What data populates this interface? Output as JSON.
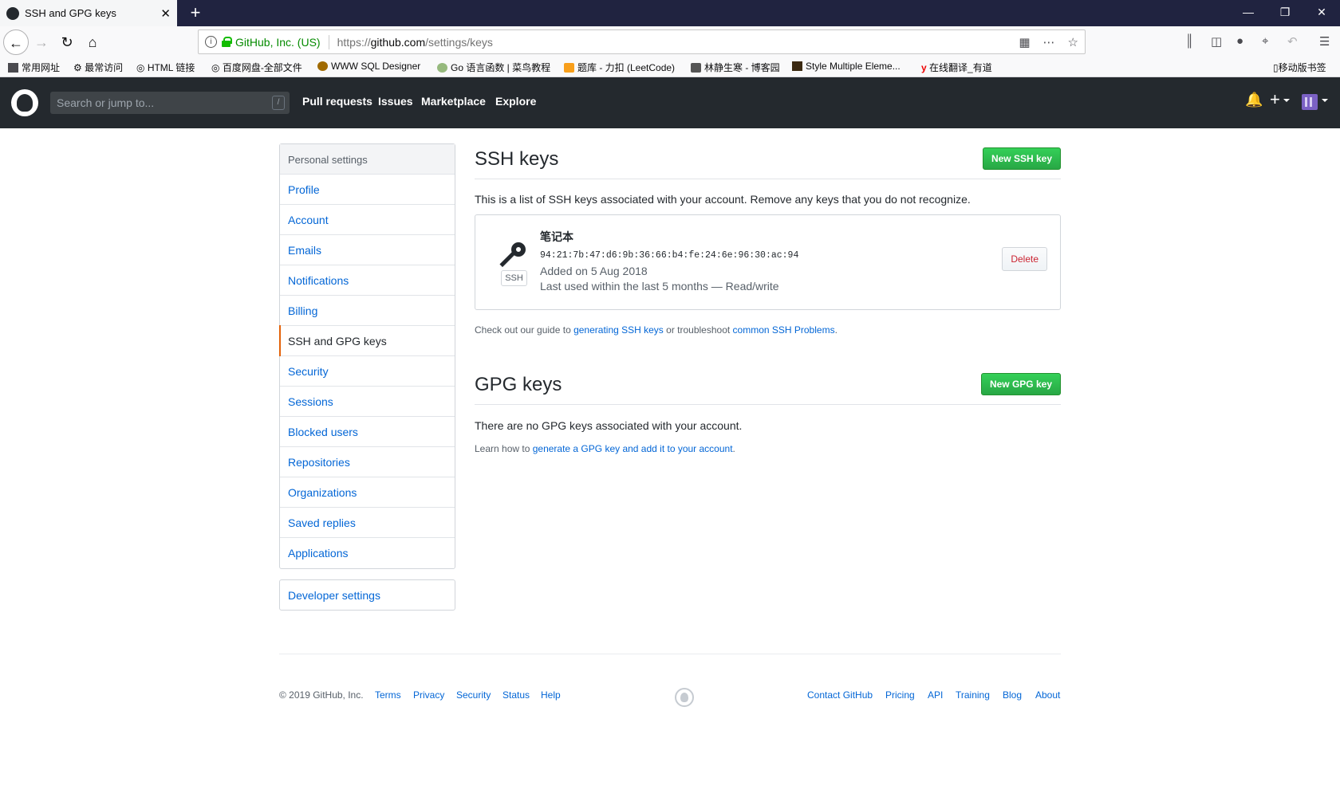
{
  "browser": {
    "tab_title": "SSH and GPG keys",
    "tab_close": "✕",
    "new_tab": "+",
    "window_controls": [
      "—",
      "❐",
      "✕"
    ],
    "url_identity": "GitHub, Inc. (US)",
    "url_prefix": "https://",
    "url_domain": "github.com",
    "url_path": "/settings/keys",
    "url_icons": [
      "qr-code-icon",
      "more-icon",
      "bookmark-star-icon"
    ],
    "toolbar_icons": [
      "library-icon",
      "sidebar-icon",
      "chat-icon",
      "crop-icon",
      "undo-icon",
      "menu-icon"
    ],
    "bookmarks": [
      "常用网址",
      "最常访问",
      "HTML 链接",
      "百度网盘-全部文件",
      "WWW SQL Designer",
      "Go 语言函数 | 菜鸟教程",
      "题库 - 力扣 (LeetCode)",
      "林静生寒 - 博客园",
      "Style Multiple Eleme...",
      "在线翻译_有道"
    ],
    "mobile_bookmarks": "移动版书签"
  },
  "github_header": {
    "search_placeholder": "Search or jump to...",
    "search_shortcut": "/",
    "nav": [
      "Pull requests",
      "Issues",
      "Marketplace",
      "Explore"
    ]
  },
  "sidebar": {
    "heading": "Personal settings",
    "items": [
      {
        "label": "Profile"
      },
      {
        "label": "Account"
      },
      {
        "label": "Emails"
      },
      {
        "label": "Notifications"
      },
      {
        "label": "Billing"
      },
      {
        "label": "SSH and GPG keys",
        "selected": true
      },
      {
        "label": "Security"
      },
      {
        "label": "Sessions"
      },
      {
        "label": "Blocked users"
      },
      {
        "label": "Repositories"
      },
      {
        "label": "Organizations"
      },
      {
        "label": "Saved replies"
      },
      {
        "label": "Applications"
      }
    ],
    "developer_settings": "Developer settings"
  },
  "ssh": {
    "title": "SSH keys",
    "new_button": "New SSH key",
    "description": "This is a list of SSH keys associated with your account. Remove any keys that you do not recognize.",
    "key": {
      "name": "笔记本",
      "fingerprint": "94:21:7b:47:d6:9b:36:66:b4:fe:24:6e:96:30:ac:94",
      "added": "Added on 5 Aug 2018",
      "last_used": "Last used within the last 5 months — Read/write",
      "badge": "SSH",
      "delete_label": "Delete"
    },
    "guide_prefix": "Check out our guide to ",
    "guide_link1": "generating SSH keys",
    "guide_middle": " or troubleshoot ",
    "guide_link2": "common SSH Problems",
    "guide_suffix": "."
  },
  "gpg": {
    "title": "GPG keys",
    "new_button": "New GPG key",
    "empty": "There are no GPG keys associated with your account.",
    "learn_prefix": "Learn how to ",
    "learn_link": "generate a GPG key and add it to your account",
    "learn_suffix": "."
  },
  "footer": {
    "copyright": "© 2019 GitHub, Inc.",
    "left_links": [
      "Terms",
      "Privacy",
      "Security",
      "Status",
      "Help"
    ],
    "right_links": [
      "Contact GitHub",
      "Pricing",
      "API",
      "Training",
      "Blog",
      "About"
    ]
  }
}
